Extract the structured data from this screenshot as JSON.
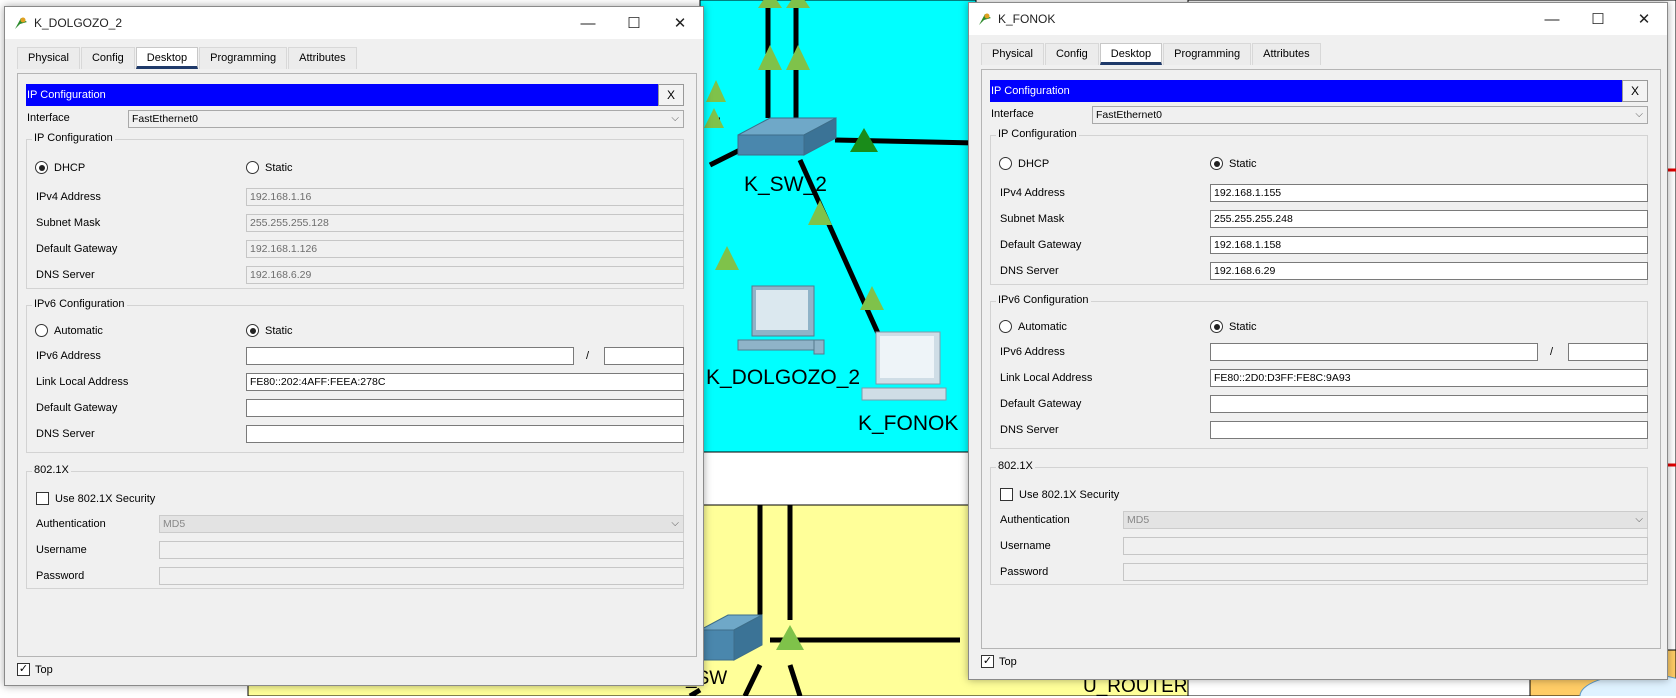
{
  "canvas": {
    "colors": {
      "cyan_area": "#00ffff",
      "yellow_area": "#ffff99",
      "link": "#000000",
      "link_up": "#1a8c1a",
      "link_up_light": "#7fc24a"
    },
    "labels": {
      "k_sw_2": "K_SW_2",
      "k_dolgozo_2": "K_DOLGOZO_2",
      "k_fonok": "K_FONOK",
      "partial_sw": "_SW",
      "partial_router": "U_ROUTER"
    }
  },
  "windows": [
    {
      "title": "K_DOLGOZO_2",
      "controls": {
        "minimize": "—",
        "maximize": "☐",
        "close": "✕"
      },
      "tabs": [
        "Physical",
        "Config",
        "Desktop",
        "Programming",
        "Attributes"
      ],
      "active_tab": "Desktop",
      "panel_title": "IP Configuration",
      "panel_close": "X",
      "interface_label": "Interface",
      "interface_value": "FastEthernet0",
      "ipv4": {
        "group_title": "IP Configuration",
        "dhcp_label": "DHCP",
        "static_label": "Static",
        "mode": "DHCP",
        "fields": [
          {
            "label": "IPv4 Address",
            "value": "192.168.1.16"
          },
          {
            "label": "Subnet Mask",
            "value": "255.255.255.128"
          },
          {
            "label": "Default Gateway",
            "value": "192.168.1.126"
          },
          {
            "label": "DNS Server",
            "value": "192.168.6.29"
          }
        ]
      },
      "ipv6": {
        "group_title": "IPv6 Configuration",
        "automatic_label": "Automatic",
        "static_label": "Static",
        "mode": "Static",
        "address_label": "IPv6 Address",
        "address_value": "",
        "prefix_separator": "/",
        "prefix_value": "",
        "fields": [
          {
            "label": "Link Local Address",
            "value": "FE80::202:4AFF:FEEA:278C"
          },
          {
            "label": "Default Gateway",
            "value": ""
          },
          {
            "label": "DNS Server",
            "value": ""
          }
        ]
      },
      "dot1x": {
        "group_title": "802.1X",
        "use_label": "Use 802.1X Security",
        "use_checked": false,
        "auth_label": "Authentication",
        "auth_value": "MD5",
        "username_label": "Username",
        "username_value": "",
        "password_label": "Password",
        "password_value": ""
      },
      "top_label": "Top",
      "top_checked": true
    },
    {
      "title": "K_FONOK",
      "controls": {
        "minimize": "—",
        "maximize": "☐",
        "close": "✕"
      },
      "tabs": [
        "Physical",
        "Config",
        "Desktop",
        "Programming",
        "Attributes"
      ],
      "active_tab": "Desktop",
      "panel_title": "IP Configuration",
      "panel_close": "X",
      "interface_label": "Interface",
      "interface_value": "FastEthernet0",
      "ipv4": {
        "group_title": "IP Configuration",
        "dhcp_label": "DHCP",
        "static_label": "Static",
        "mode": "Static",
        "fields": [
          {
            "label": "IPv4 Address",
            "value": "192.168.1.155"
          },
          {
            "label": "Subnet Mask",
            "value": "255.255.255.248"
          },
          {
            "label": "Default Gateway",
            "value": "192.168.1.158"
          },
          {
            "label": "DNS Server",
            "value": "192.168.6.29"
          }
        ]
      },
      "ipv6": {
        "group_title": "IPv6 Configuration",
        "automatic_label": "Automatic",
        "static_label": "Static",
        "mode": "Static",
        "address_label": "IPv6 Address",
        "address_value": "",
        "prefix_separator": "/",
        "prefix_value": "",
        "fields": [
          {
            "label": "Link Local Address",
            "value": "FE80::2D0:D3FF:FE8C:9A93"
          },
          {
            "label": "Default Gateway",
            "value": ""
          },
          {
            "label": "DNS Server",
            "value": ""
          }
        ]
      },
      "dot1x": {
        "group_title": "802.1X",
        "use_label": "Use 802.1X Security",
        "use_checked": false,
        "auth_label": "Authentication",
        "auth_value": "MD5",
        "username_label": "Username",
        "username_value": "",
        "password_label": "Password",
        "password_value": ""
      },
      "top_label": "Top",
      "top_checked": true
    }
  ]
}
